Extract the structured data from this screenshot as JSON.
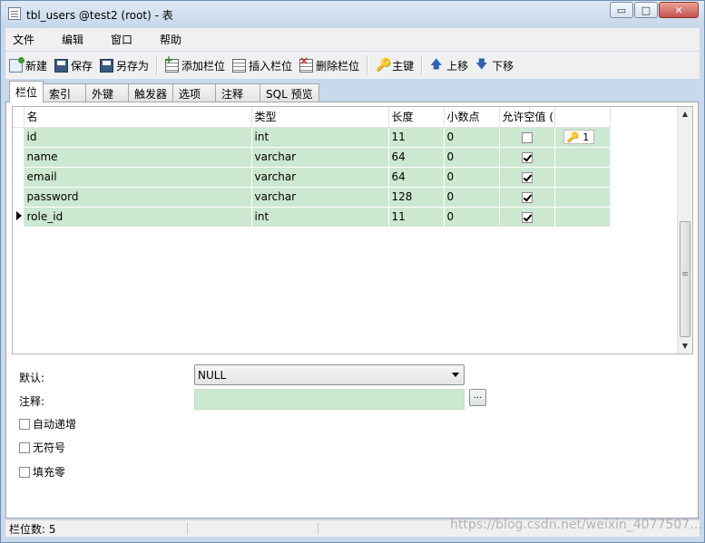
{
  "window": {
    "title": "tbl_users @test2 (root) - 表",
    "min_glyph": "▭",
    "max_glyph": "□",
    "close_glyph": "✕"
  },
  "menu": [
    "文件",
    "编辑",
    "窗口",
    "帮助"
  ],
  "toolbar": {
    "new": "新建",
    "save": "保存",
    "save_as": "另存为",
    "add_field": "添加栏位",
    "insert_field": "插入栏位",
    "delete_field": "删除栏位",
    "primary_key": "主键",
    "move_up": "上移",
    "move_down": "下移"
  },
  "tabs": [
    "栏位",
    "索引",
    "外键",
    "触发器",
    "选项",
    "注释",
    "SQL 预览"
  ],
  "active_tab": "栏位",
  "columns": [
    "名",
    "类型",
    "长度",
    "小数点",
    "允许空值 ("
  ],
  "fields": [
    {
      "name": "id",
      "type": "int",
      "length": "11",
      "decimals": "0",
      "allow_null": false,
      "key": "1",
      "current": false
    },
    {
      "name": "name",
      "type": "varchar",
      "length": "64",
      "decimals": "0",
      "allow_null": true,
      "key": "",
      "current": false
    },
    {
      "name": "email",
      "type": "varchar",
      "length": "64",
      "decimals": "0",
      "allow_null": true,
      "key": "",
      "current": false
    },
    {
      "name": "password",
      "type": "varchar",
      "length": "128",
      "decimals": "0",
      "allow_null": true,
      "key": "",
      "current": false
    },
    {
      "name": "role_id",
      "type": "int",
      "length": "11",
      "decimals": "0",
      "allow_null": true,
      "key": "",
      "current": true
    }
  ],
  "properties": {
    "default_label": "默认:",
    "default_value": "NULL",
    "comment_label": "注释:",
    "comment_value": "",
    "ellipsis": "...",
    "auto_increment": "自动递增",
    "unsigned": "无符号",
    "zerofill": "填充零"
  },
  "status": {
    "field_count": "栏位数: 5"
  },
  "watermark": "https://blog.csdn.net/weixin_4077507…",
  "colors": {
    "row_bg": "#cde8d1",
    "window_frame": "#c9d9ec"
  },
  "icons": {
    "key": "🔑",
    "up": "🡅",
    "down": "🡇"
  }
}
